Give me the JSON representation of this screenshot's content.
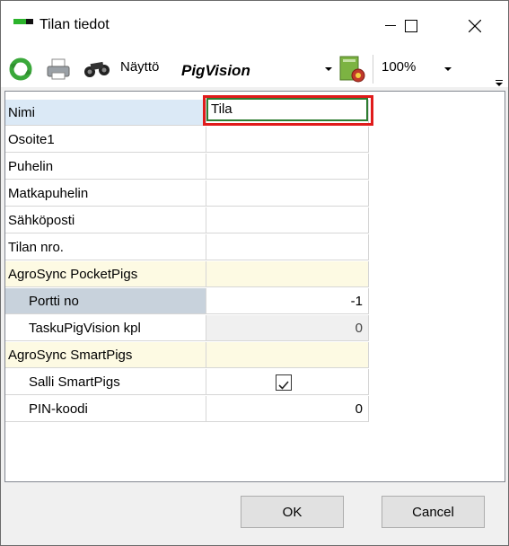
{
  "window": {
    "title": "Tilan tiedot"
  },
  "toolbar": {
    "view_label": "Näyttö",
    "view_value": "PigVision",
    "zoom_value": "100%"
  },
  "properties": {
    "nimi": {
      "label": "Nimi",
      "value": "Tila"
    },
    "osoite": {
      "label": "Osoite1",
      "value": ""
    },
    "puhelin": {
      "label": "Puhelin",
      "value": ""
    },
    "matkapuhelin": {
      "label": "Matkapuhelin",
      "value": ""
    },
    "sahkoposti": {
      "label": "Sähköposti",
      "value": ""
    },
    "tilan_nro": {
      "label": "Tilan nro.",
      "value": ""
    },
    "pocketpigs": {
      "label": "AgroSync PocketPigs"
    },
    "portti": {
      "label": "Portti no",
      "value": "-1"
    },
    "taskupigvision": {
      "label": "TaskuPigVision kpl",
      "value": "0"
    },
    "smartpigs": {
      "label": "AgroSync SmartPigs"
    },
    "salli": {
      "label": "Salli SmartPigs",
      "checked": true
    },
    "pin": {
      "label": "PIN-koodi",
      "value": "0"
    }
  },
  "buttons": {
    "ok": "OK",
    "cancel": "Cancel"
  },
  "colors": {
    "highlight": "#e01b1b",
    "category_bg": "#fdfae3",
    "selected_bg": "#dbe9f6"
  },
  "icons": [
    "refresh-icon",
    "print-icon",
    "binoculars-icon",
    "settings-report-icon",
    "minimize-icon",
    "maximize-icon",
    "close-icon"
  ]
}
